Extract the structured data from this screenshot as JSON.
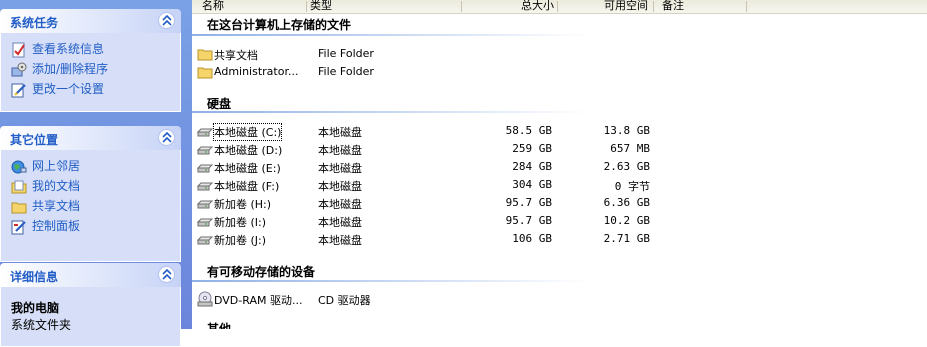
{
  "task_pane": {
    "system_tasks": {
      "title": "系统任务",
      "items": [
        {
          "label": "查看系统信息",
          "icon": "system-info-icon"
        },
        {
          "label": "添加/删除程序",
          "icon": "add-remove-programs-icon"
        },
        {
          "label": "更改一个设置",
          "icon": "change-setting-icon"
        }
      ]
    },
    "other_places": {
      "title": "其它位置",
      "items": [
        {
          "label": "网上邻居",
          "icon": "network-places-icon"
        },
        {
          "label": "我的文档",
          "icon": "my-documents-icon"
        },
        {
          "label": "共享文档",
          "icon": "shared-documents-icon"
        },
        {
          "label": "控制面板",
          "icon": "control-panel-icon"
        }
      ]
    },
    "details": {
      "title": "详细信息",
      "name": "我的电脑",
      "type": "系统文件夹"
    }
  },
  "columns": {
    "name": "名称",
    "type": "类型",
    "total_size": "总大小",
    "free_space": "可用空间",
    "comments": "备注"
  },
  "groups": {
    "stored_files": {
      "title": "在这台计算机上存储的文件",
      "items": [
        {
          "name": "共享文档",
          "type": "File Folder"
        },
        {
          "name": "Administrator...",
          "type": "File Folder"
        }
      ]
    },
    "hard_disks": {
      "title": "硬盘",
      "items": [
        {
          "name": "本地磁盘 (C:)",
          "type": "本地磁盘",
          "total": "58.5 GB",
          "free": "13.8 GB"
        },
        {
          "name": "本地磁盘 (D:)",
          "type": "本地磁盘",
          "total": "259 GB",
          "free": "657 MB"
        },
        {
          "name": "本地磁盘 (E:)",
          "type": "本地磁盘",
          "total": "284 GB",
          "free": "2.63 GB"
        },
        {
          "name": "本地磁盘 (F:)",
          "type": "本地磁盘",
          "total": "304 GB",
          "free": "0 字节"
        },
        {
          "name": "新加卷 (H:)",
          "type": "本地磁盘",
          "total": "95.7 GB",
          "free": "6.36 GB"
        },
        {
          "name": "新加卷 (I:)",
          "type": "本地磁盘",
          "total": "95.7 GB",
          "free": "10.2 GB"
        },
        {
          "name": "新加卷 (J:)",
          "type": "本地磁盘",
          "total": "106 GB",
          "free": "2.71 GB"
        }
      ]
    },
    "removable": {
      "title": "有可移动存储的设备",
      "items": [
        {
          "name": "DVD-RAM 驱动...",
          "type": "CD 驱动器"
        }
      ]
    },
    "other": {
      "title": "其他"
    }
  },
  "colors": {
    "task_link": "#215dc6",
    "pane_background": "#6b85dc",
    "group_rule": "#90b0e6"
  }
}
